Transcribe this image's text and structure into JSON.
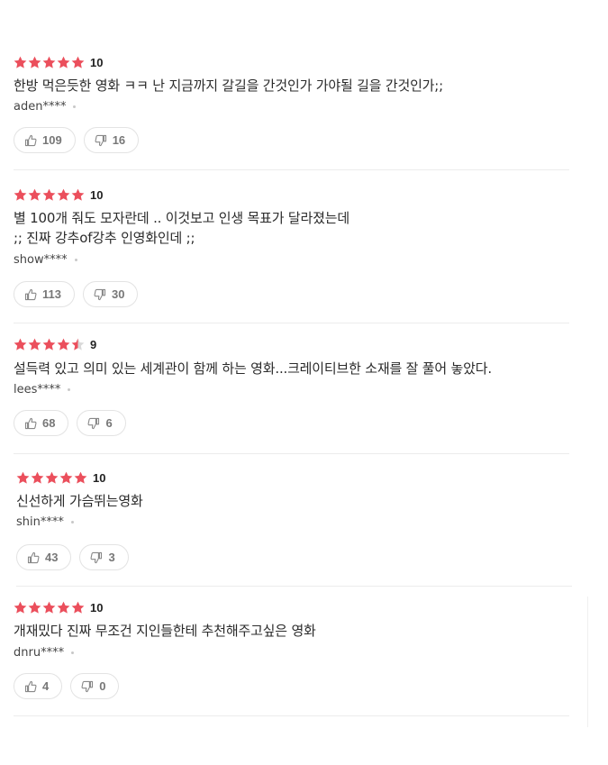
{
  "colors": {
    "star_filled": "#eb4f5c",
    "star_empty": "#d9d9d9",
    "vote_text": "#777777"
  },
  "reviews": [
    {
      "stars": 5,
      "score": "10",
      "text": "한방 먹은듯한 영화 ㅋㅋ 난 지금까지 갈길을 간것인가 가야될 길을 간것인가;;",
      "author": "aden****",
      "likes": "109",
      "dislikes": "16"
    },
    {
      "stars": 5,
      "score": "10",
      "text": "별 100개 줘도 모자란데 .. 이것보고 인생 목표가 달라졌는데\n;; 진짜 강추of강추 인영화인데 ;;",
      "author": "show****",
      "likes": "113",
      "dislikes": "30"
    },
    {
      "stars": 4.5,
      "score": "9",
      "text": "설득력 있고 의미 있는 세계관이 함께 하는 영화...크레이티브한 소재를 잘 풀어 놓았다.",
      "author": "lees****",
      "likes": "68",
      "dislikes": "6"
    },
    {
      "stars": 5,
      "score": "10",
      "text": "신선하게 가슴뛰는영화",
      "author": "shin****",
      "likes": "43",
      "dislikes": "3"
    },
    {
      "stars": 5,
      "score": "10",
      "text": "개재밌다 진짜 무조건 지인들한테 추천해주고싶은 영화",
      "author": "dnru****",
      "likes": "4",
      "dislikes": "0"
    }
  ],
  "icons": {
    "like": "thumbs-up-icon",
    "dislike": "thumbs-down-icon",
    "star": "star-icon"
  }
}
